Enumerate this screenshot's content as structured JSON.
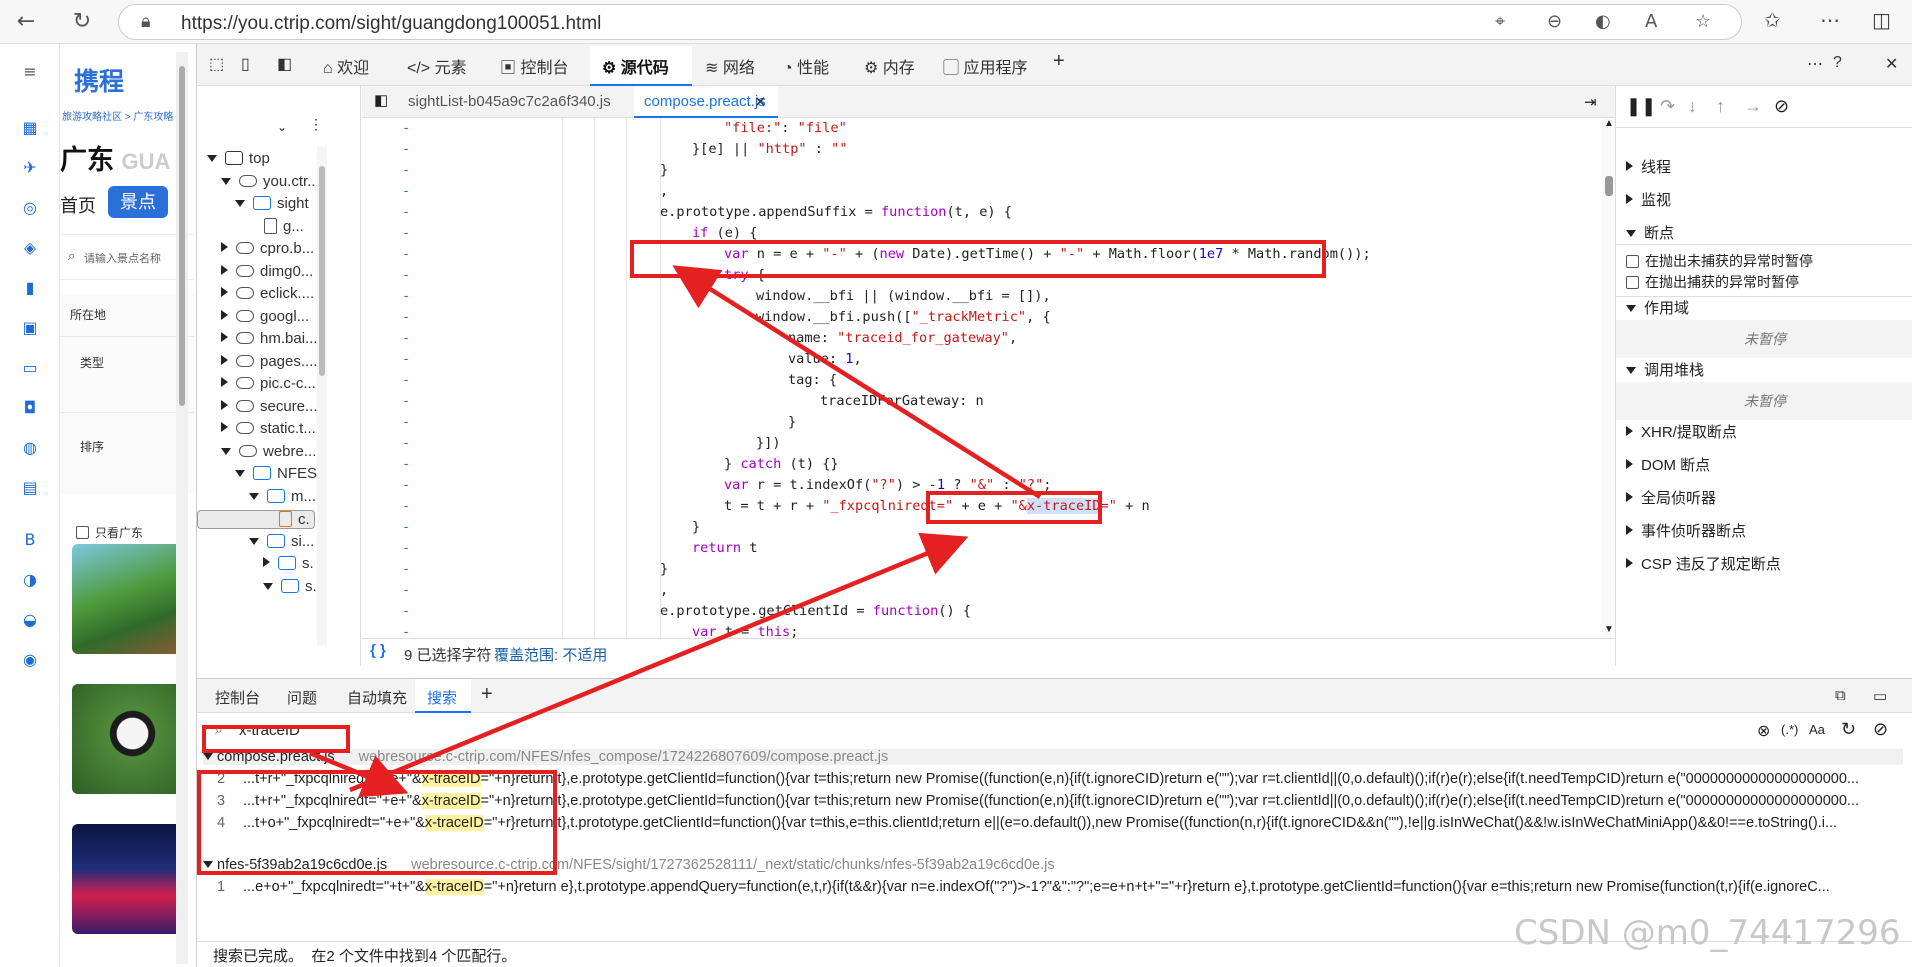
{
  "browser": {
    "url": "https://you.ctrip.com/sight/guangdong100051.html"
  },
  "page": {
    "logo": "携程",
    "breadcrumb": "旅游攻略社区 > 广东攻略",
    "city_title": "广东",
    "city_en": "GUA",
    "nav_home": "首页",
    "nav_sight": "景点",
    "search_placeholder": "请输入景点名称",
    "filters": [
      "所在地",
      "类型",
      "排序"
    ],
    "only_guangdong": "只看广东"
  },
  "devtools": {
    "tabs": [
      "欢迎",
      "元素",
      "控制台",
      "源代码",
      "网络",
      "性能",
      "内存",
      "应用程序"
    ],
    "active_tab": "源代码",
    "file_tree": [
      {
        "label": "top",
        "depth": 0,
        "icon": "frame",
        "open": true
      },
      {
        "label": "you.ctr...",
        "depth": 1,
        "icon": "cloud",
        "open": true
      },
      {
        "label": "sight",
        "depth": 2,
        "icon": "folder",
        "open": true
      },
      {
        "label": "g...",
        "depth": 3,
        "icon": "file",
        "open": null
      },
      {
        "label": "cpro.b...",
        "depth": 1,
        "icon": "cloud",
        "open": false
      },
      {
        "label": "dimg0...",
        "depth": 1,
        "icon": "cloud",
        "open": false
      },
      {
        "label": "eclick....",
        "depth": 1,
        "icon": "cloud",
        "open": false
      },
      {
        "label": "googl...",
        "depth": 1,
        "icon": "cloud",
        "open": false
      },
      {
        "label": "hm.bai...",
        "depth": 1,
        "icon": "cloud",
        "open": false
      },
      {
        "label": "pages....",
        "depth": 1,
        "icon": "cloud",
        "open": false
      },
      {
        "label": "pic.c-c...",
        "depth": 1,
        "icon": "cloud",
        "open": false
      },
      {
        "label": "secure....",
        "depth": 1,
        "icon": "cloud",
        "open": false
      },
      {
        "label": "static.t...",
        "depth": 1,
        "icon": "cloud",
        "open": false
      },
      {
        "label": "webre...",
        "depth": 1,
        "icon": "cloud",
        "open": true
      },
      {
        "label": "NFES",
        "depth": 2,
        "icon": "folder",
        "open": true
      },
      {
        "label": "m...",
        "depth": 3,
        "icon": "folder",
        "open": true
      },
      {
        "label": "c.",
        "depth": 4,
        "icon": "file",
        "open": null
      },
      {
        "label": "si...",
        "depth": 3,
        "icon": "folder",
        "open": true
      },
      {
        "label": "s.",
        "depth": 4,
        "icon": "folder",
        "open": false
      },
      {
        "label": "s.",
        "depth": 4,
        "icon": "folder",
        "open": true
      }
    ],
    "editor_tabs": [
      "sightList-b045a9c7c2a6f340.js",
      "compose.preact.js"
    ],
    "active_editor_tab": "compose.preact.js",
    "status_selected": "9 已选择字符",
    "status_coverage": "覆盖范围: 不适用",
    "debugger_sections": [
      "线程",
      "监视",
      "断点"
    ],
    "pause_uncaught": "在抛出未捕获的异常时暂停",
    "pause_caught": "在抛出捕获的异常时暂停",
    "scope_label": "作用域",
    "not_paused": "未暂停",
    "callstack_label": "调用堆栈",
    "more_sections": [
      "XHR/提取断点",
      "DOM 断点",
      "全局侦听器",
      "事件侦听器断点",
      "CSP 违反了规定断点"
    ],
    "drawer_tabs": [
      "控制台",
      "问题",
      "自动填充",
      "搜索"
    ],
    "active_drawer_tab": "搜索",
    "search_query": "x-traceID",
    "search_results": [
      {
        "file": "compose.preact.js",
        "url": "webresource.c-ctrip.com/NFES/nfes_compose/1724226807609/compose.preact.js",
        "lines": [
          {
            "no": "2",
            "pre": "...t+r+\"_fxpcqlniredt=\"+e+\"&",
            "match": "x-traceID",
            "post": "=\"+n}return t},e.prototype.getClientId=function(){var t=this;return new Promise((function(e,n){if(t.ignoreCID)return e(\"\");var r=t.clientId||(0,o.default)();if(r)e(r);else{if(t.needTempCID)return e(\"00000000000000000000..."
          },
          {
            "no": "3",
            "pre": "...t+r+\"_fxpcqlniredt=\"+e+\"&",
            "match": "x-traceID",
            "post": "=\"+n}return t},e.prototype.getClientId=function(){var t=this;return new Promise((function(e,n){if(t.ignoreCID)return e(\"\");var r=t.clientId||(0,o.default)();if(r)e(r);else{if(t.needTempCID)return e(\"00000000000000000000..."
          },
          {
            "no": "4",
            "pre": "...t+o+\"_fxpcqlniredt=\"+e+\"&",
            "match": "x-traceID",
            "post": "=\"+r}return t},t.prototype.getClientId=function(){var t=this,e=this.clientId;return e||(e=o.default()),new Promise((function(n,r){if(t.ignoreCID&&n(\"\"),!e||g.isInWeChat()&&!w.isInWeChatMiniApp()&&0!==e.toString().i..."
          }
        ]
      },
      {
        "file": "nfes-5f39ab2a19c6cd0e.js",
        "url": "webresource.c-ctrip.com/NFES/sight/1727362528111/_next/static/chunks/nfes-5f39ab2a19c6cd0e.js",
        "lines": [
          {
            "no": "1",
            "pre": "...e+o+\"_fxpcqlniredt=\"+t+\"&",
            "match": "x-traceID",
            "post": "=\"+n}return e},t.prototype.appendQuery=function(e,t,r){if(t&&r){var n=e.indexOf(\"?\")>-1?\"&\":\"?\";e=e+n+t+\"=\"+r}return e},t.prototype.getClientId=function(){var e=this;return new Promise(function(t,r){if(e.ignoreC..."
          }
        ]
      }
    ],
    "search_summary": "搜索已完成。  在2 个文件中找到4 个匹配行。"
  },
  "watermark": "CSDN @m0_74417296"
}
